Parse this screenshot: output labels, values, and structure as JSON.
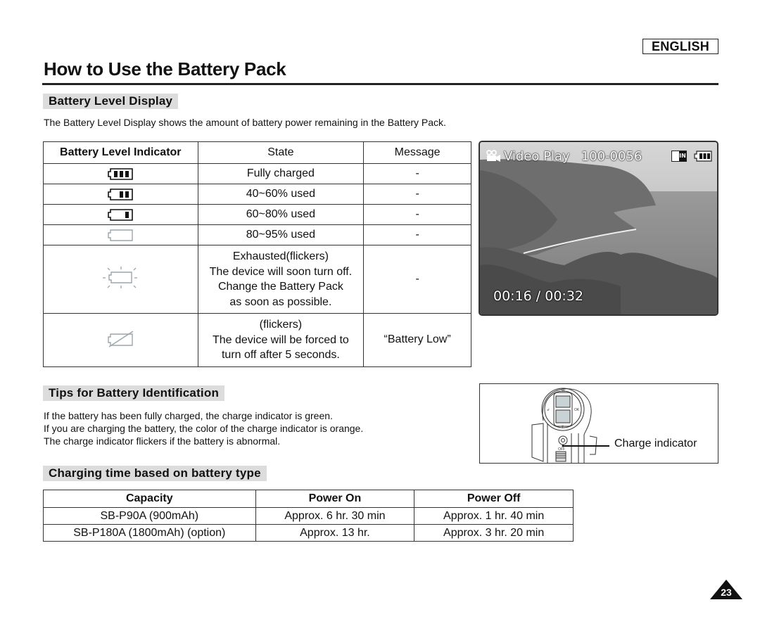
{
  "header": {
    "language_badge": "ENGLISH",
    "page_title": "How to Use the Battery Pack"
  },
  "battery_level_display": {
    "heading": "Battery Level Display",
    "description": "The Battery Level Display shows the amount of battery power remaining in the Battery Pack.",
    "table": {
      "headers": [
        "Battery Level Indicator",
        "State",
        "Message"
      ],
      "rows": [
        {
          "icon": "battery-full-icon",
          "state": [
            "Fully charged"
          ],
          "message": "-"
        },
        {
          "icon": "battery-two-bars-icon",
          "state": [
            "40~60% used"
          ],
          "message": "-"
        },
        {
          "icon": "battery-one-bar-icon",
          "state": [
            "60~80% used"
          ],
          "message": "-"
        },
        {
          "icon": "battery-empty-icon",
          "state": [
            "80~95% used"
          ],
          "message": "-"
        },
        {
          "icon": "battery-exhausted-flicker-icon",
          "state": [
            "Exhausted(flickers)",
            "The device will soon turn off.",
            "Change the Battery Pack",
            "as soon as possible."
          ],
          "message": "-"
        },
        {
          "icon": "battery-dead-icon",
          "state": [
            "(flickers)",
            "The device will be forced to",
            "turn off after 5 seconds."
          ],
          "message": "“Battery Low”"
        }
      ]
    }
  },
  "screen_preview": {
    "mode_icon": "video-camera-icon",
    "mode_label": "Video Play",
    "file_number": "100-0056",
    "memory_badge": "IN",
    "battery_icon": "battery-full-icon",
    "time": "00:16 / 00:32"
  },
  "tips": {
    "heading": "Tips for Battery Identification",
    "lines": [
      "If the battery has been fully charged, the charge indicator is green.",
      "If you are charging the battery, the color of the charge indicator is orange.",
      "The charge indicator flickers if the battery is abnormal."
    ],
    "figure_label": "Charge indicator",
    "figure_button_labels": {
      "top": "W",
      "bottom": "T",
      "left": "↲",
      "right": "OK",
      "switch": "OFF"
    }
  },
  "charging_time": {
    "heading": "Charging time based on battery type",
    "headers": [
      "Capacity",
      "Power On",
      "Power Off"
    ],
    "rows": [
      [
        "SB-P90A (900mAh)",
        "Approx. 6 hr. 30 min",
        "Approx. 1 hr. 40 min"
      ],
      [
        "SB-P180A (1800mAh) (option)",
        "Approx. 13 hr.",
        "Approx. 3 hr. 20 min"
      ]
    ]
  },
  "footer": {
    "page_number": "23"
  }
}
